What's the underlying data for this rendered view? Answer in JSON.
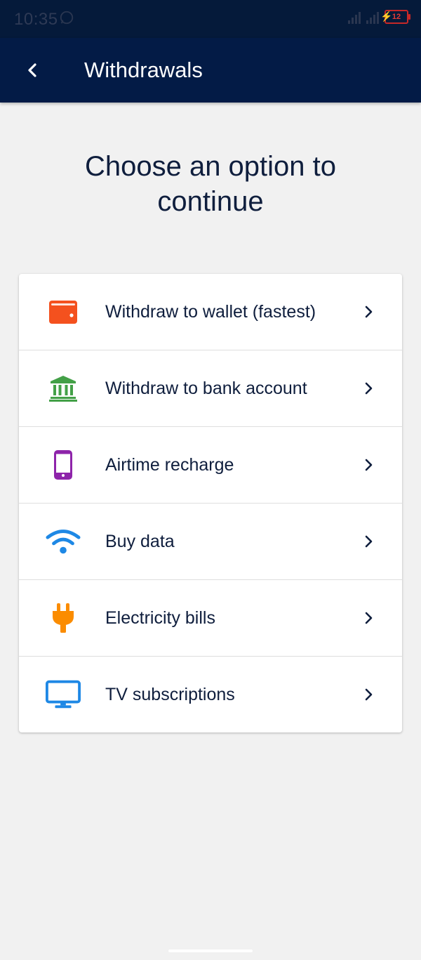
{
  "status_bar": {
    "time": "10:35",
    "battery": "12",
    "icons": [
      "whatsapp-icon",
      "signal-icon",
      "battery-icon"
    ]
  },
  "header": {
    "title": "Withdrawals",
    "back_icon": "chevron-left-icon"
  },
  "main": {
    "heading_line1": "Choose an option to",
    "heading_line2": "continue",
    "options": [
      {
        "label": "Withdraw to wallet (fastest)",
        "icon": "wallet-icon",
        "icon_color": "#f4511e"
      },
      {
        "label": "Withdraw to bank account",
        "icon": "bank-icon",
        "icon_color": "#43a047"
      },
      {
        "label": "Airtime recharge",
        "icon": "phone-icon",
        "icon_color": "#8e24aa"
      },
      {
        "label": "Buy data",
        "icon": "wifi-icon",
        "icon_color": "#1e88e5"
      },
      {
        "label": "Electricity bills",
        "icon": "power-plug-icon",
        "icon_color": "#fb8c00"
      },
      {
        "label": "TV subscriptions",
        "icon": "tv-icon",
        "icon_color": "#1e88e5"
      }
    ]
  },
  "colors": {
    "app_bar": "#031b46",
    "background": "#f1f1f1",
    "text": "#0f1e3d"
  }
}
